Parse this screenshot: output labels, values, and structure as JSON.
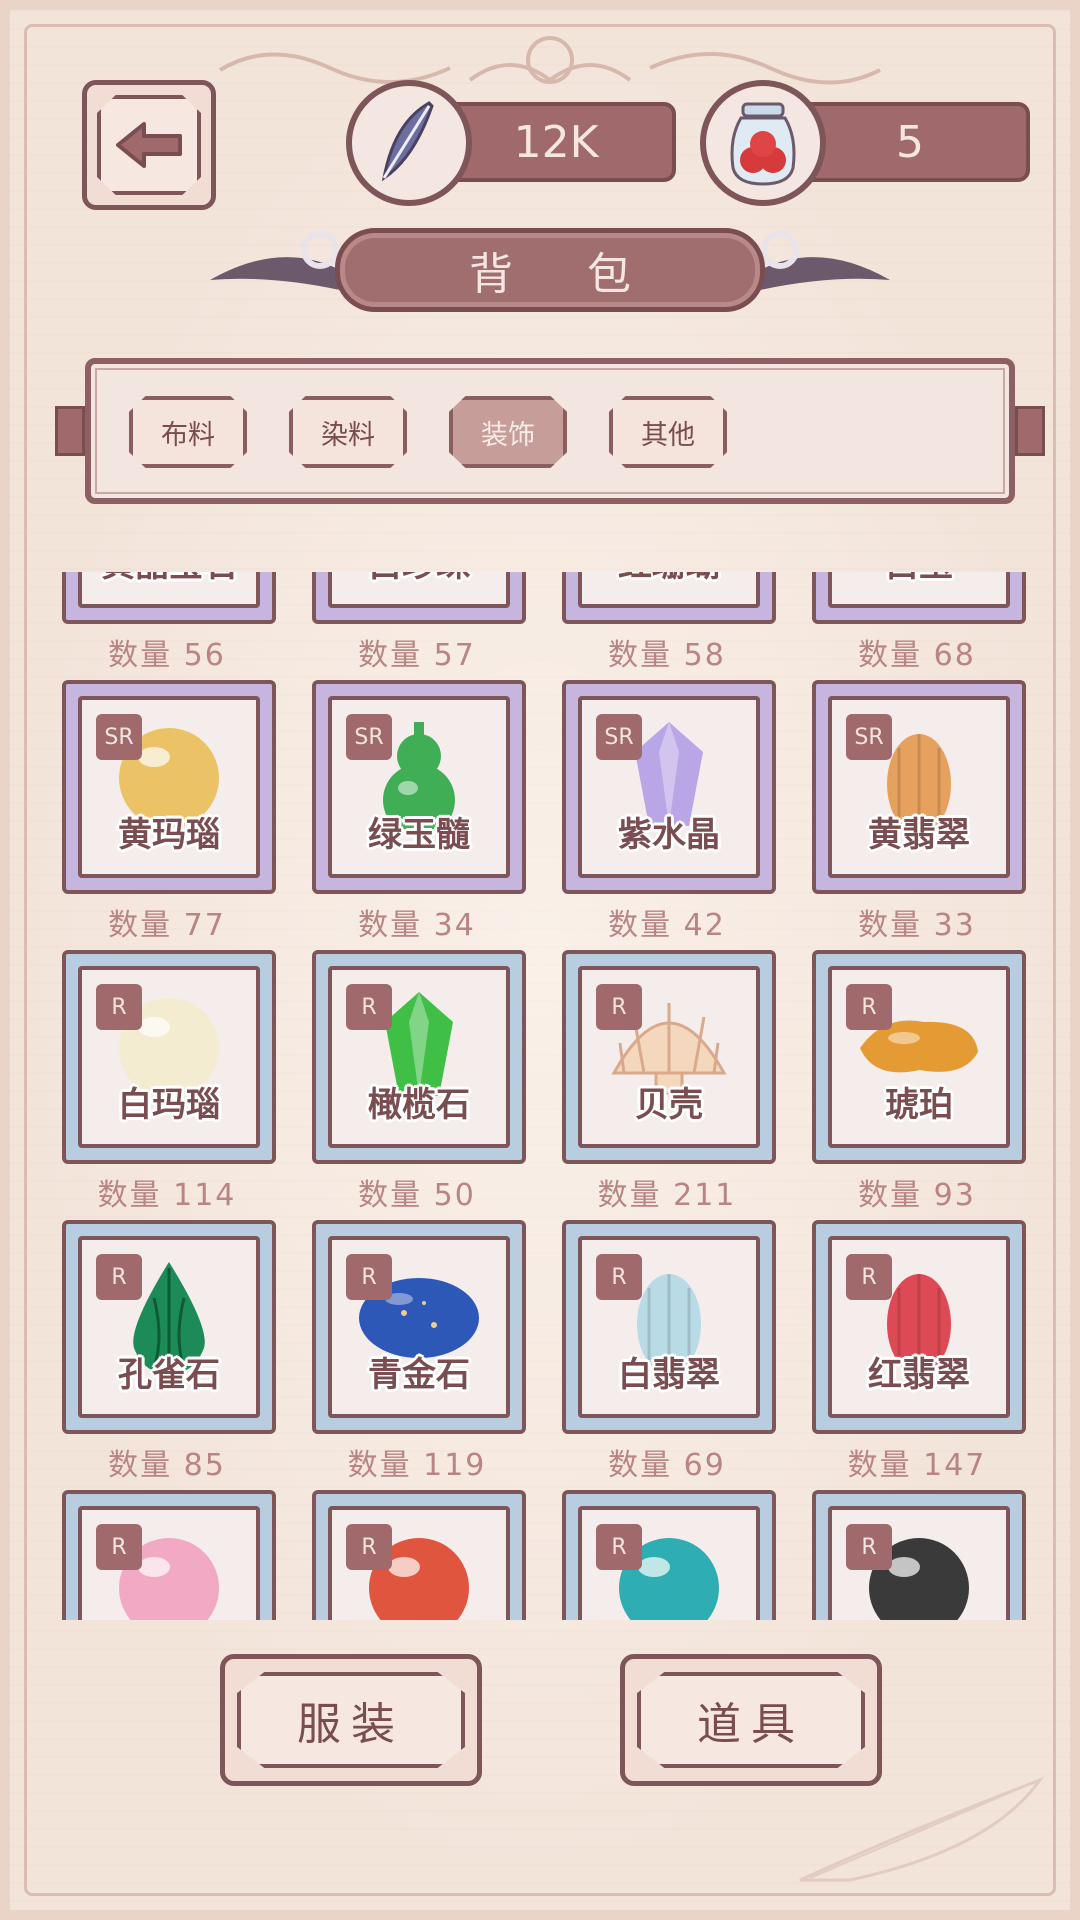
{
  "header": {
    "currency_feather": {
      "value": "12K",
      "icon": "feather-icon"
    },
    "currency_jar": {
      "value": "5",
      "icon": "berry-jar-icon"
    },
    "back_icon": "arrow-left-icon",
    "title": "背 包"
  },
  "tabs": [
    {
      "label": "布料",
      "active": false
    },
    {
      "label": "染料",
      "active": false
    },
    {
      "label": "装饰",
      "active": true
    },
    {
      "label": "其他",
      "active": false
    }
  ],
  "items": [
    {
      "name": "黄晶宝石",
      "qty": "数量 56",
      "rarity": "SR",
      "tier": "sr",
      "color": "#f2c55e",
      "shape": "round"
    },
    {
      "name": "白珍珠",
      "qty": "数量 57",
      "rarity": "SR",
      "tier": "sr",
      "color": "#e3e8f2",
      "shape": "round"
    },
    {
      "name": "红珊瑚",
      "qty": "数量 58",
      "rarity": "SR",
      "tier": "sr",
      "color": "#d9584a",
      "shape": "coral"
    },
    {
      "name": "白玉",
      "qty": "数量 68",
      "rarity": "SR",
      "tier": "sr",
      "color": "#a9ddd0",
      "shape": "jade"
    },
    {
      "name": "黄玛瑙",
      "qty": "数量 77",
      "rarity": "SR",
      "tier": "sr",
      "color": "#ecc266",
      "shape": "round"
    },
    {
      "name": "绿玉髓",
      "qty": "数量 34",
      "rarity": "SR",
      "tier": "sr",
      "color": "#3fae55",
      "shape": "gourd"
    },
    {
      "name": "紫水晶",
      "qty": "数量 42",
      "rarity": "SR",
      "tier": "sr",
      "color": "#b9a6e6",
      "shape": "crystal"
    },
    {
      "name": "黄翡翠",
      "qty": "数量 33",
      "rarity": "SR",
      "tier": "sr",
      "color": "#e6a15e",
      "shape": "cabbage"
    },
    {
      "name": "白玛瑙",
      "qty": "数量 114",
      "rarity": "R",
      "tier": "r",
      "color": "#f3ecd1",
      "shape": "round"
    },
    {
      "name": "橄榄石",
      "qty": "数量 50",
      "rarity": "R",
      "tier": "r",
      "color": "#3fbf45",
      "shape": "crystal"
    },
    {
      "name": "贝壳",
      "qty": "数量 211",
      "rarity": "R",
      "tier": "r",
      "color": "#f3d8be",
      "shape": "shell"
    },
    {
      "name": "琥珀",
      "qty": "数量 93",
      "rarity": "R",
      "tier": "r",
      "color": "#e59b33",
      "shape": "amber"
    },
    {
      "name": "孔雀石",
      "qty": "数量 85",
      "rarity": "R",
      "tier": "r",
      "color": "#1d8b58",
      "shape": "drop"
    },
    {
      "name": "青金石",
      "qty": "数量 119",
      "rarity": "R",
      "tier": "r",
      "color": "#2d58b8",
      "shape": "oval"
    },
    {
      "name": "白翡翠",
      "qty": "数量 69",
      "rarity": "R",
      "tier": "r",
      "color": "#b8dbe6",
      "shape": "cabbage"
    },
    {
      "name": "红翡翠",
      "qty": "数量 147",
      "rarity": "R",
      "tier": "r",
      "color": "#dd4a55",
      "shape": "cabbage"
    },
    {
      "name": "",
      "qty": "",
      "rarity": "R",
      "tier": "r",
      "color": "#f2a9c4",
      "shape": "round"
    },
    {
      "name": "",
      "qty": "",
      "rarity": "R",
      "tier": "r",
      "color": "#e0553e",
      "shape": "round"
    },
    {
      "name": "",
      "qty": "",
      "rarity": "R",
      "tier": "r",
      "color": "#2eaeb2",
      "shape": "round"
    },
    {
      "name": "",
      "qty": "",
      "rarity": "R",
      "tier": "r",
      "color": "#3a3a3a",
      "shape": "round"
    }
  ],
  "bottom": {
    "clothing_label": "服装",
    "props_label": "道具"
  }
}
